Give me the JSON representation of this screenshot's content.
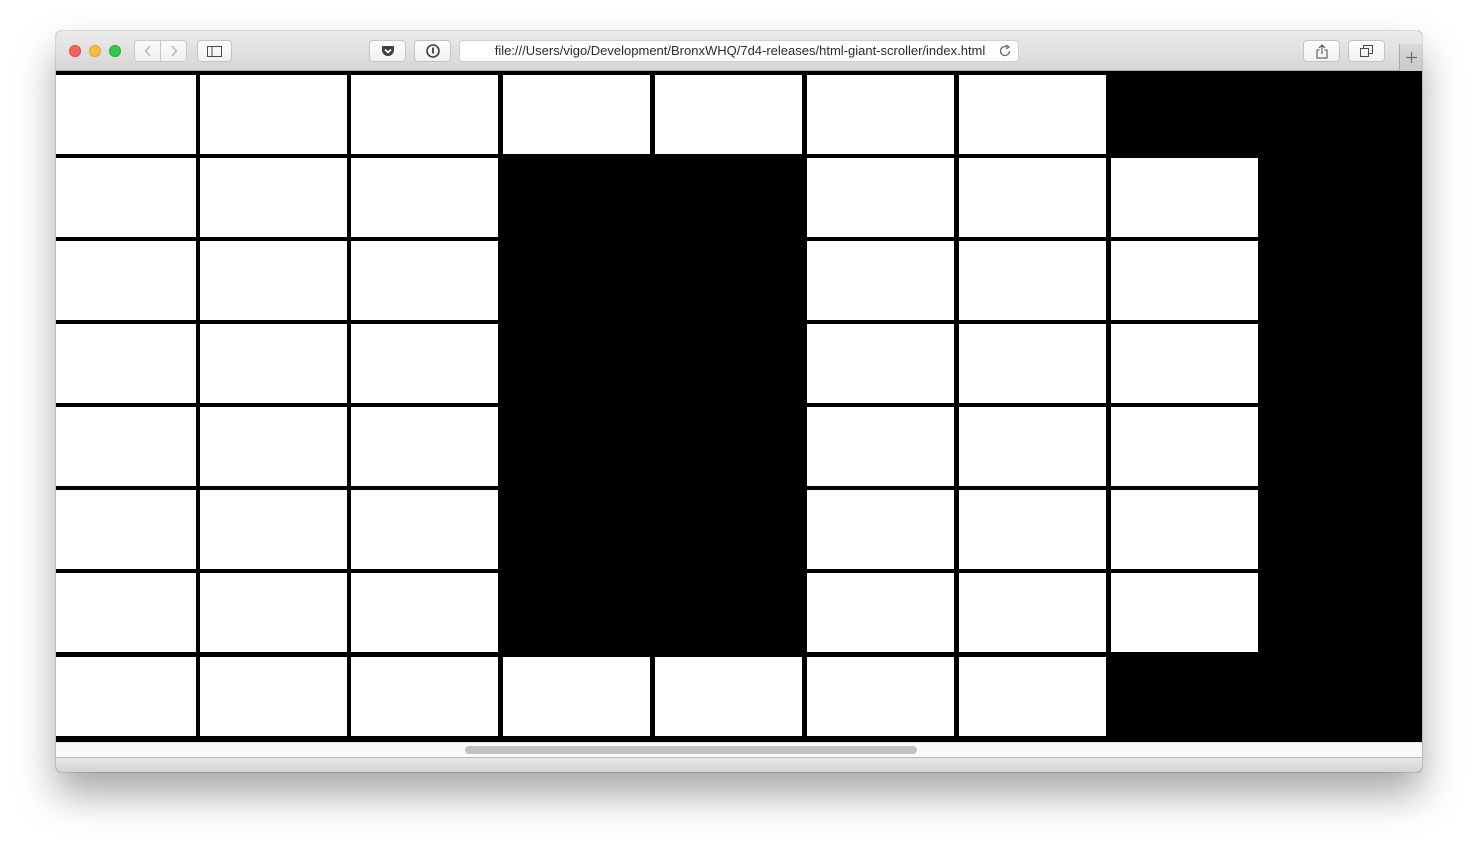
{
  "browser": {
    "url": "file:///Users/vigo/Development/BronxWHQ/7d4-releases/html-giant-scroller/index.html",
    "traffic_lights": {
      "close": "#fc605c",
      "minimize": "#fdbc40",
      "zoom": "#34c84a"
    },
    "icons": [
      "back-icon",
      "forward-icon",
      "sidebar-icon",
      "pocket-icon",
      "info-icon",
      "reload-icon",
      "share-icon",
      "tabs-icon",
      "new-tab-icon"
    ]
  },
  "page": {
    "background": "#000000",
    "tile_color": "#ffffff",
    "grid": {
      "columns": 9,
      "rows": 8
    },
    "tiles": [
      [
        1,
        1,
        1,
        1,
        1,
        1,
        1,
        0,
        0
      ],
      [
        1,
        1,
        1,
        0,
        0,
        1,
        1,
        1,
        0
      ],
      [
        1,
        1,
        1,
        0,
        0,
        1,
        1,
        1,
        0
      ],
      [
        1,
        1,
        1,
        0,
        0,
        1,
        1,
        1,
        0
      ],
      [
        1,
        1,
        1,
        0,
        0,
        1,
        1,
        1,
        0
      ],
      [
        1,
        1,
        1,
        0,
        0,
        1,
        1,
        1,
        0
      ],
      [
        1,
        1,
        1,
        0,
        0,
        1,
        1,
        1,
        0
      ],
      [
        1,
        1,
        1,
        1,
        1,
        1,
        1,
        0,
        0
      ]
    ]
  }
}
